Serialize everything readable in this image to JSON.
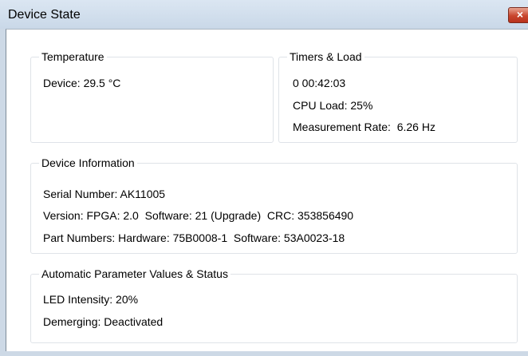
{
  "window": {
    "title": "Device State",
    "close_glyph": "×"
  },
  "temperature": {
    "legend": "Temperature",
    "device": "Device: 29.5 °C"
  },
  "timers": {
    "legend": "Timers & Load",
    "uptime": "0 00:42:03",
    "cpu_load": "CPU Load: 25%",
    "measurement_rate": "Measurement Rate:  6.26 Hz"
  },
  "device_info": {
    "legend": "Device Information",
    "serial": "Serial Number: AK11005",
    "version": "Version: FPGA: 2.0  Software: 21 (Upgrade)  CRC: 353856490",
    "part_numbers": "Part Numbers: Hardware: 75B0008-1  Software: 53A0023-18"
  },
  "auto_params": {
    "legend": "Automatic Parameter Values & Status",
    "led_intensity": "LED Intensity: 20%",
    "demerging": "Demerging: Deactivated"
  }
}
